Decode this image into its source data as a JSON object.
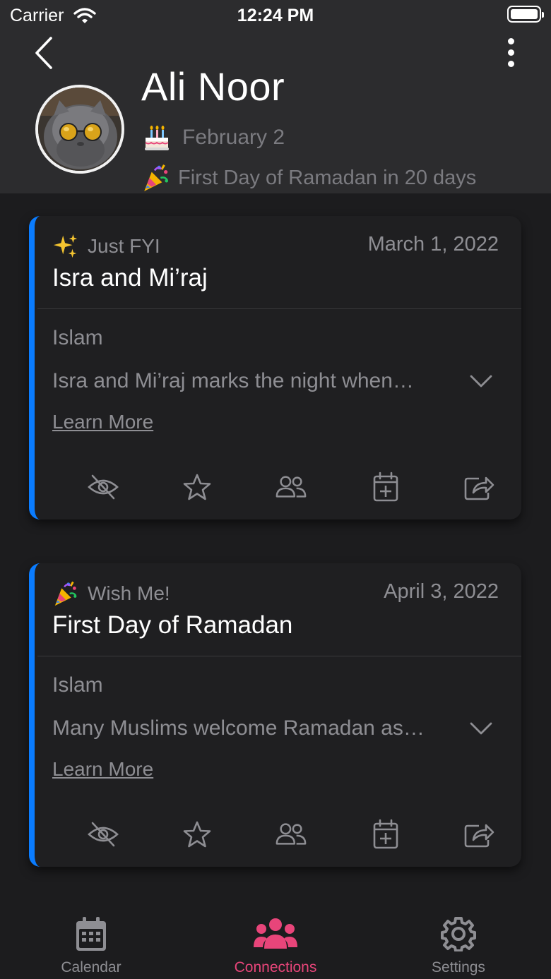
{
  "status_bar": {
    "carrier": "Carrier",
    "time": "12:24 PM"
  },
  "profile": {
    "name": "Ali Noor",
    "birthday": "February 2",
    "upcoming": "First Day of Ramadan in 20 days"
  },
  "cards": [
    {
      "tag": "Just FYI",
      "tag_icon": "sparkles-icon",
      "date": "March 1, 2022",
      "title": "Isra and Mi’raj",
      "category": "Islam",
      "description": "Isra and Mi’raj marks the night when…",
      "learn_more": "Learn More"
    },
    {
      "tag": "Wish Me!",
      "tag_icon": "party-popper-icon",
      "date": "April 3, 2022",
      "title": "First Day of Ramadan",
      "category": "Islam",
      "description": "Many Muslims welcome Ramadan as…",
      "learn_more": "Learn More"
    }
  ],
  "card_actions": [
    "hide-icon",
    "star-icon",
    "people-icon",
    "calendar-add-icon",
    "share-icon"
  ],
  "tabbar": {
    "tabs": [
      {
        "label": "Calendar",
        "icon": "calendar-icon",
        "active": false
      },
      {
        "label": "Connections",
        "icon": "people-group-icon",
        "active": true
      },
      {
        "label": "Settings",
        "icon": "gear-icon",
        "active": false
      }
    ]
  },
  "colors": {
    "accent": "#0a7cff",
    "active_tab": "#e8457a",
    "muted_text": "#8e8e93",
    "header_bg": "#2c2c2e",
    "page_bg": "#1c1c1e"
  }
}
